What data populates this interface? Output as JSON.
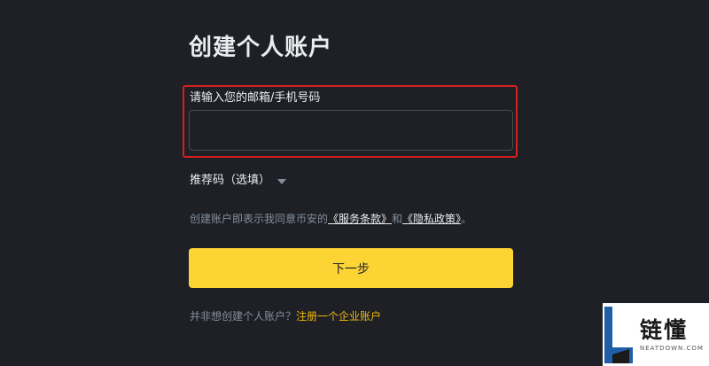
{
  "page": {
    "title": "创建个人账户"
  },
  "email_field": {
    "label": "请输入您的邮箱/手机号码",
    "value": "",
    "placeholder": ""
  },
  "referral": {
    "label": "推荐码（选填）",
    "icon": "caret-down-icon"
  },
  "terms": {
    "prefix": "创建账户即表示我同意币安的",
    "terms_link": "《服务条款》",
    "conjunction": "和",
    "privacy_link": "《隐私政策》",
    "suffix": "。"
  },
  "next_button": {
    "label": "下一步"
  },
  "business": {
    "prefix": "并非想创建个人账户？",
    "link": "注册一个企业账户"
  },
  "watermark": {
    "cn": "链懂",
    "en": "NEATDOWN.COM"
  },
  "colors": {
    "background": "#1e2026",
    "primary_text": "#eaecef",
    "secondary_text": "#848e9c",
    "button_yellow": "#fcd535",
    "link_yellow": "#f0b90b",
    "highlight_red": "#d62020",
    "input_border": "#474d57"
  }
}
